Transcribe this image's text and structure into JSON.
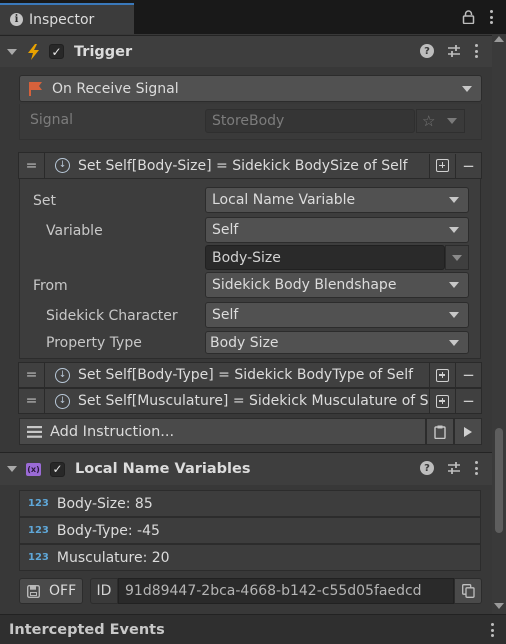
{
  "tab": {
    "title": "Inspector"
  },
  "trigger": {
    "title": "Trigger",
    "event": "On Receive Signal",
    "signal_label": "Signal",
    "signal_value": "StoreBody"
  },
  "instructions": [
    {
      "text": "Set Self[Body-Size] = Sidekick BodySize of Self",
      "fields": {
        "set_label": "Set",
        "set_value": "Local Name Variable",
        "variable_label": "Variable",
        "variable_value": "Self",
        "variable_name": "Body-Size",
        "from_label": "From",
        "from_value": "Sidekick Body Blendshape",
        "character_label": "Sidekick Character",
        "character_value": "Self",
        "property_label": "Property Type",
        "property_value": "Body Size"
      }
    },
    {
      "text": "Set Self[Body-Type] = Sidekick BodyType of Self"
    },
    {
      "text": "Set Self[Musculature] = Sidekick Musculature of Self"
    }
  ],
  "add_instruction": "Add Instruction...",
  "local_vars": {
    "title": "Local Name Variables",
    "type_badge": "123",
    "items": [
      "Body-Size: 85",
      "Body-Type: -45",
      "Musculature: 20"
    ],
    "save_label": "OFF",
    "id_label": "ID",
    "id_value": "91d89447-2bca-4668-b142-c55d05faedcd"
  },
  "footer": {
    "title": "Intercepted Events"
  },
  "colors": {
    "accent_tab": "#3a79bb",
    "trigger_icon": "#e8a200",
    "flag": "#d5613b",
    "vars_icon": "#9b6bd6",
    "int_badge": "#5fa7d8"
  }
}
